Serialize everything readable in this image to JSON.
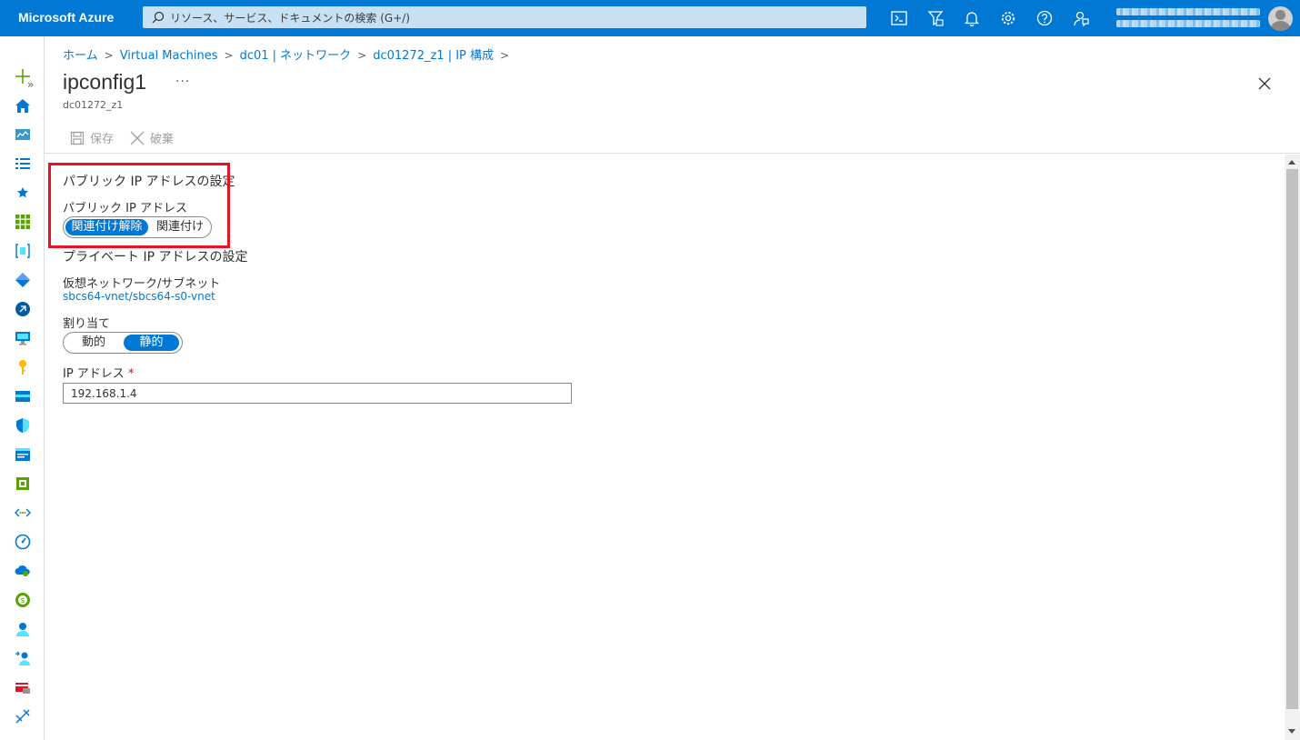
{
  "topbar": {
    "brand": "Microsoft Azure",
    "search_placeholder": "リソース、サービス、ドキュメントの検索 (G+/)",
    "icons": [
      "cloud-shell-icon",
      "directory-filter-icon",
      "notifications-icon",
      "settings-icon",
      "help-icon",
      "feedback-icon"
    ],
    "color": "#0078d4"
  },
  "breadcrumb": [
    "ホーム",
    "Virtual Machines",
    "dc01 | ネットワーク",
    "dc01272_z1 | IP 構成"
  ],
  "page": {
    "title": "ipconfig1",
    "more": "···",
    "subtitle": "dc01272_z1"
  },
  "commands": {
    "save": "保存",
    "discard": "破棄"
  },
  "public_ip": {
    "section": "パブリック IP アドレスの設定",
    "label": "パブリック IP アドレス",
    "options": [
      "関連付け解除",
      "関連付け"
    ],
    "selected": "関連付け解除"
  },
  "private_ip": {
    "section": "プライベート IP アドレスの設定",
    "vnet_label": "仮想ネットワーク/サブネット",
    "vnet_value": "sbcs64-vnet/sbcs64-s0-vnet",
    "assign_label": "割り当て",
    "assign_options": [
      "動的",
      "静的"
    ],
    "assign_selected": "静的",
    "ip_label": "IP アドレス",
    "ip_required": "*",
    "ip_value": "192.168.1.4"
  },
  "highlight_color": "#e81123"
}
